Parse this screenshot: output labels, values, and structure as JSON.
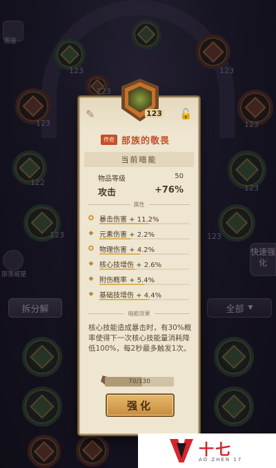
{
  "background": {
    "node_levels": [
      "123",
      "123",
      "123",
      "123",
      "123",
      "123",
      "123",
      "122",
      "123",
      "123",
      "123"
    ],
    "quick_button": "快速强化",
    "left_top_label": "图鉴",
    "left_mid_label": "部落威望",
    "split_button": "拆分解",
    "filter_dropdown": "全部"
  },
  "card": {
    "hero_level": "123",
    "rarity": "传奇",
    "name": "部族的敬畏",
    "subtitle": "当前暗能",
    "item_level_label": "物品等级",
    "item_level_value": "50",
    "attack_label": "攻击",
    "attack_value": "+76%",
    "attributes_header": "属性",
    "attributes": [
      {
        "text": "暴击伤害 + 11.2%",
        "bullet": "special",
        "fill": 0.55
      },
      {
        "text": "元素伤害 + 2.2%",
        "bullet": "diamond",
        "fill": 0.35
      },
      {
        "text": "物理伤害 + 4.2%",
        "bullet": "special",
        "fill": 0.45
      },
      {
        "text": "核心技增伤 + 2.6%",
        "bullet": "diamond",
        "fill": 0.4
      },
      {
        "text": "附伤概率 + 5.4%",
        "bullet": "diamond",
        "fill": 0.5
      },
      {
        "text": "基础技增伤 + 4.4%",
        "bullet": "diamond",
        "fill": 0.55
      }
    ],
    "effect_header": "暗能效果",
    "effect_text": "核心技能造成暴击时，有30%概率使得下一次核心技能量消耗降低100%，每2秒最多触发1次。",
    "progress_current": 70,
    "progress_max": 130,
    "progress_text": "70/130",
    "upgrade_button": "强化"
  },
  "watermark": {
    "title": "十七",
    "subtitle": "AO ZHEN 17"
  },
  "colors": {
    "card_bg": "#efe6d2",
    "name_red": "#c4502a",
    "button_gold": "#d8a454",
    "accent_brand": "#d6262d"
  }
}
